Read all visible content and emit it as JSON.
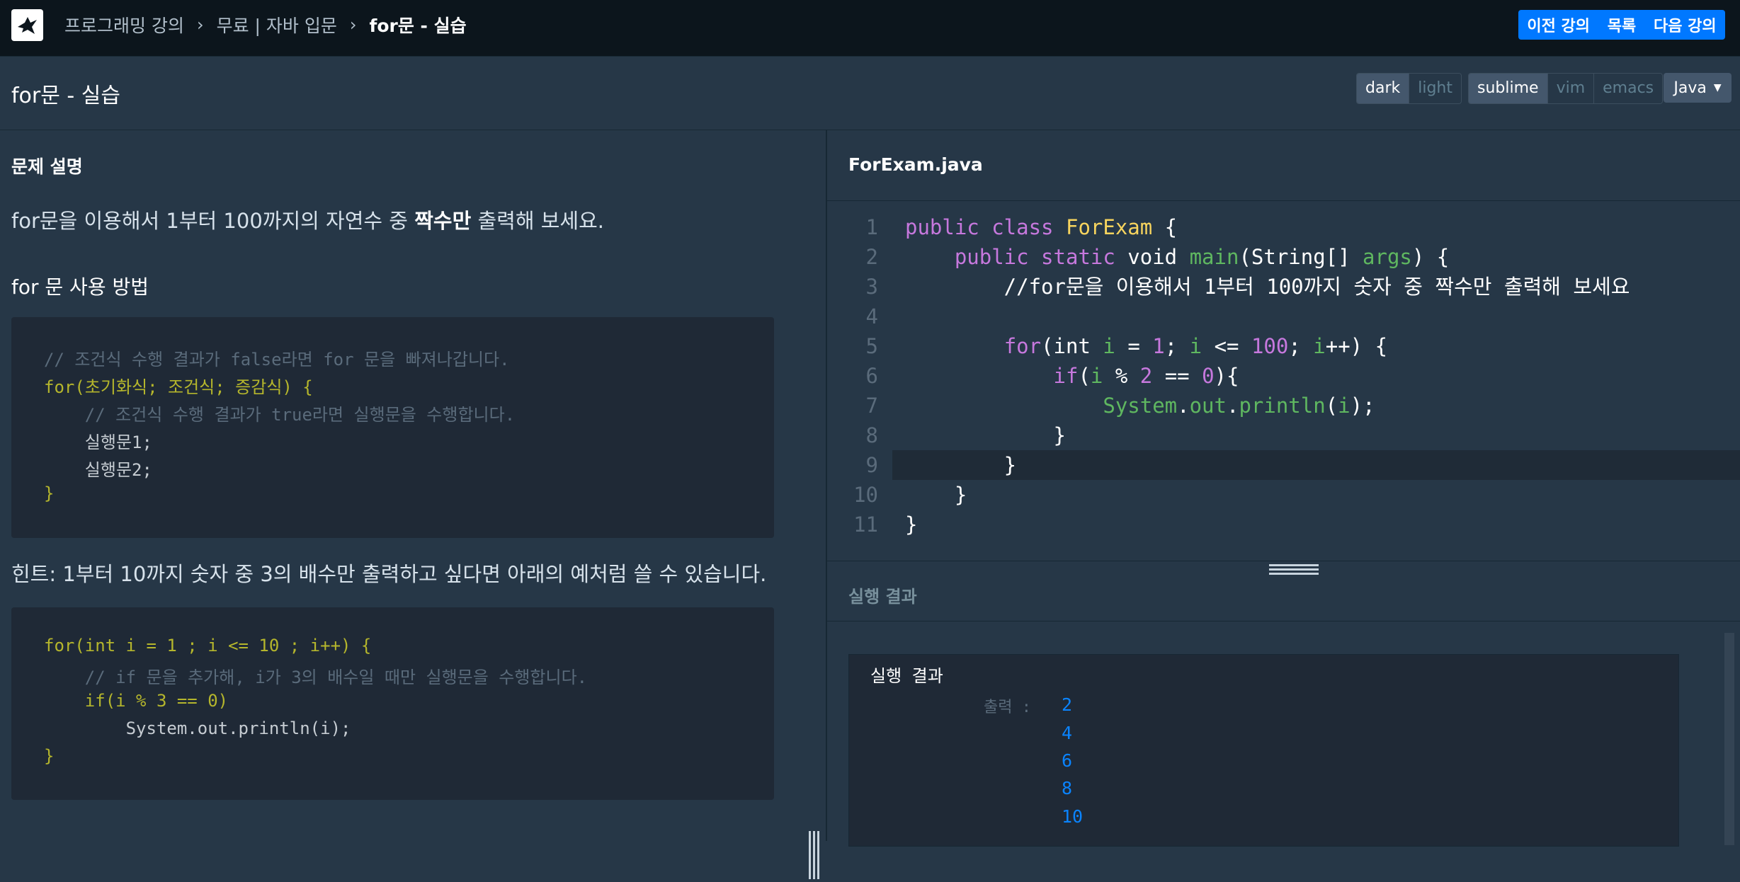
{
  "breadcrumb": {
    "items": [
      "프로그래밍 강의",
      "무료 | 자바 입문",
      "for문 - 실습"
    ]
  },
  "nav": {
    "prev": "이전 강의",
    "list": "목록",
    "next": "다음 강의"
  },
  "page_title": "for문 - 실습",
  "theme_toggle": {
    "options": [
      "dark",
      "light"
    ],
    "selected": "dark"
  },
  "keymap_toggle": {
    "options": [
      "sublime",
      "vim",
      "emacs"
    ],
    "selected": "sublime"
  },
  "language_select": {
    "value": "Java"
  },
  "problem": {
    "heading": "문제 설명",
    "description_pre": "for문을 이용해서 1부터 100까지의 자연수 중 ",
    "description_bold": "짝수만",
    "description_post": " 출력해 보세요.",
    "usage_heading": "for 문 사용 방법",
    "usage_code": [
      "// 조건식 수행 결과가 false라면 for 문을 빠져나갑니다.",
      "for(초기화식; 조건식; 증감식) {",
      "    // 조건식 수행 결과가 true라면 실행문을 수행합니다.",
      "    실행문1;",
      "    실행문2;",
      "}"
    ],
    "hint": "힌트: 1부터 10까지 숫자 중 3의 배수만 출력하고 싶다면 아래의 예처럼 쓸 수 있습니다.",
    "hint_code": [
      "for(int i = 1 ; i <= 10 ; i++) {",
      "    // if 문을 추가해, i가 3의 배수일 때만 실행문을 수행합니다.",
      "    if(i % 3 == 0)",
      "        System.out.println(i);",
      "}"
    ]
  },
  "editor": {
    "filename": "ForExam.java",
    "line_numbers": [
      "1",
      "2",
      "3",
      "4",
      "5",
      "6",
      "7",
      "8",
      "9",
      "10",
      "11"
    ],
    "lines": [
      "public class ForExam {",
      "    public static void main(String[] args) {",
      "        //for문을 이용해서 1부터 100까지 숫자 중 짝수만 출력해 보세요",
      "",
      "        for(int i = 1; i <= 100; i++) {",
      "            if(i % 2 == 0){",
      "                System.out.println(i);",
      "            }",
      "        }",
      "    }",
      "}"
    ],
    "highlighted_line": 9
  },
  "result": {
    "heading": "실행 결과",
    "console_title": "실행 결과",
    "output_label": "출력 :",
    "outputs": [
      "2",
      "4",
      "6",
      "8",
      "10"
    ]
  },
  "colors": {
    "background": "#263747",
    "topbar": "#0c151c",
    "accent": "#0078ff",
    "output": "#0a84ff"
  }
}
